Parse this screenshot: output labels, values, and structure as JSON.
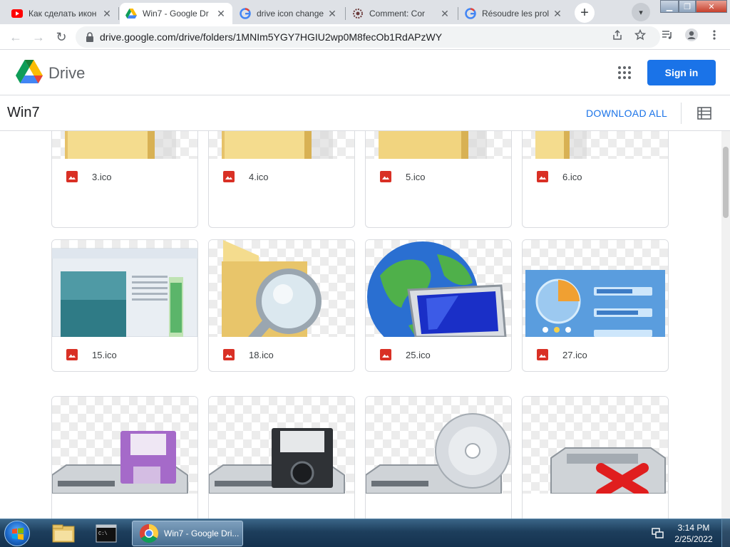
{
  "browser": {
    "tabs": [
      {
        "title": "Как сделать икон",
        "icon": "youtube-icon"
      },
      {
        "title": "Win7 - Google Dr",
        "icon": "google-drive-icon",
        "active": true
      },
      {
        "title": "drive icon change",
        "icon": "google-icon"
      },
      {
        "title": "Comment: Cor",
        "icon": "settings-icon"
      },
      {
        "title": "Résoudre les prol",
        "icon": "google-icon"
      }
    ],
    "new_tab_label": "+",
    "url": "drive.google.com/drive/folders/1MNIm5YGY7HGIU2wp0M8fecOb1RdAPzWY"
  },
  "drive": {
    "app_name": "Drive",
    "sign_in_label": "Sign in",
    "folder_title": "Win7",
    "download_all_label": "DOWNLOAD ALL",
    "files": [
      {
        "name": "3.ico",
        "preview": "folder"
      },
      {
        "name": "4.ico",
        "preview": "folder"
      },
      {
        "name": "5.ico",
        "preview": "folder"
      },
      {
        "name": "6.ico",
        "preview": "folder"
      },
      {
        "name": "15.ico",
        "preview": "window"
      },
      {
        "name": "18.ico",
        "preview": "folder-magnifier"
      },
      {
        "name": "25.ico",
        "preview": "globe-monitor"
      },
      {
        "name": "27.ico",
        "preview": "control-panel"
      },
      {
        "name": "",
        "preview": "drive-floppy-purple"
      },
      {
        "name": "",
        "preview": "drive-floppy-black"
      },
      {
        "name": "",
        "preview": "drive-cd"
      },
      {
        "name": "",
        "preview": "drive-red-x"
      }
    ]
  },
  "taskbar": {
    "task_label": "Win7 - Google Dri...",
    "time": "3:14 PM",
    "date": "2/25/2022"
  },
  "colors": {
    "accent": "#1a73e8",
    "file_icon": "#d93025",
    "taskbar": "#1d3e5c"
  }
}
